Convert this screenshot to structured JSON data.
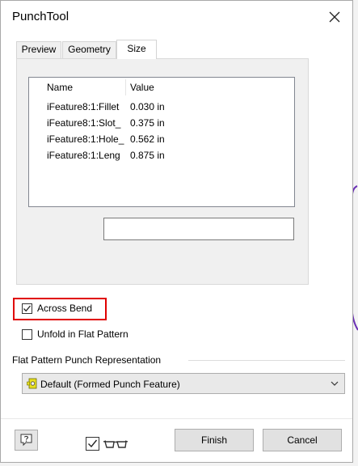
{
  "window": {
    "title": "PunchTool"
  },
  "tabs": [
    {
      "label": "Preview",
      "active": false
    },
    {
      "label": "Geometry",
      "active": false
    },
    {
      "label": "Size",
      "active": true
    }
  ],
  "size_table": {
    "columns": [
      "Name",
      "Value"
    ],
    "rows": [
      {
        "name": "iFeature8:1:Fillet",
        "value": "0.030 in"
      },
      {
        "name": "iFeature8:1:Slot_",
        "value": "0.375 in"
      },
      {
        "name": "iFeature8:1:Hole_",
        "value": "0.562 in"
      },
      {
        "name": "iFeature8:1:Leng",
        "value": "0.875 in"
      }
    ],
    "edit_value": ""
  },
  "options": {
    "across_bend": {
      "label": "Across Bend",
      "checked": true
    },
    "unfold_flat_pattern": {
      "label": "Unfold in Flat Pattern",
      "checked": false
    }
  },
  "flat_pattern": {
    "group_label": "Flat Pattern Punch Representation",
    "selected": "Default (Formed Punch Feature)"
  },
  "footer": {
    "preview_checked": true,
    "finish_label": "Finish",
    "cancel_label": "Cancel"
  },
  "colors": {
    "highlight_border": "#e00000",
    "background_curve": "#6a2fb5"
  },
  "icons": [
    "close-icon",
    "help-icon",
    "checkmark-icon",
    "glasses-icon",
    "punch-feature-icon",
    "chevron-down-icon"
  ]
}
